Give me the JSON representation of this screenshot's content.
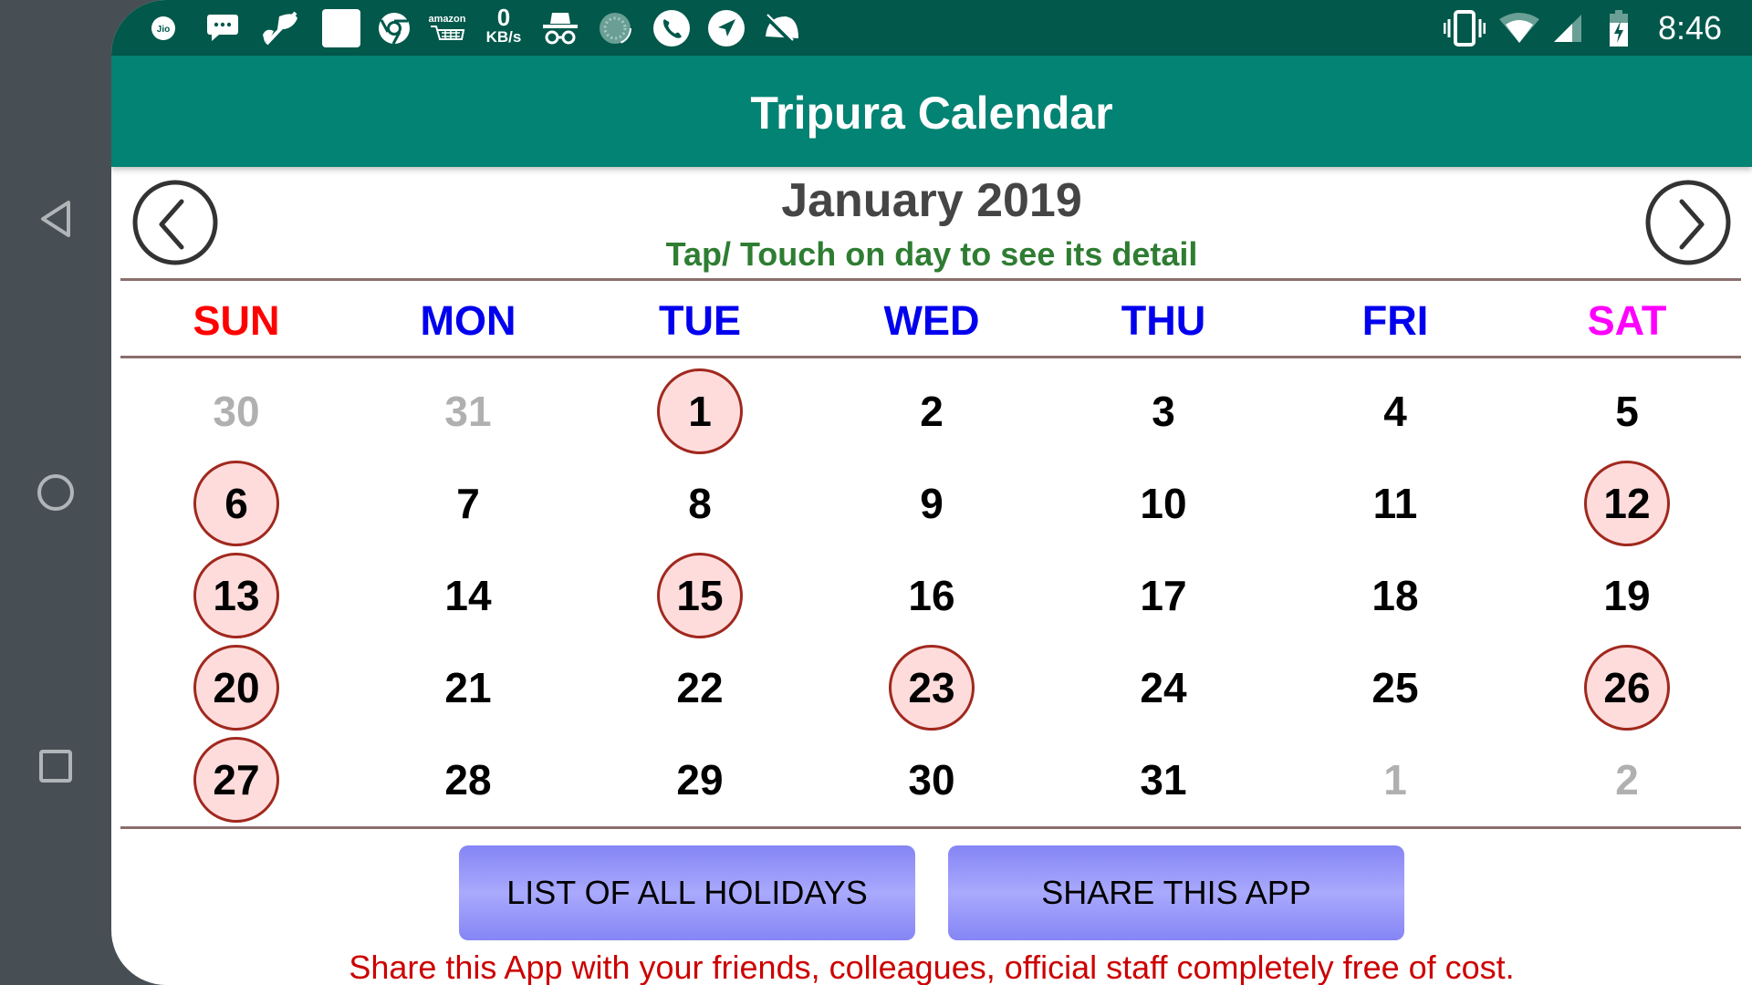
{
  "system_nav": {
    "back": "back-icon",
    "home": "home-icon",
    "recents": "recents-icon"
  },
  "status_bar": {
    "left_icons": [
      "jio-icon",
      "message-icon",
      "leaf-off-icon",
      "blank-notification-icon",
      "chrome-icon",
      "amazon-cart-icon"
    ],
    "net_speed_value": "0",
    "net_speed_unit": "KB/s",
    "left_icons_2": [
      "incognito-icon",
      "loading-icon",
      "phone-icon",
      "navigation-icon",
      "data-saver-off-icon"
    ],
    "right_icons": [
      "vibrate-icon",
      "wifi-icon",
      "signal-icon",
      "battery-charging-icon"
    ],
    "time": "8:46"
  },
  "app_bar": {
    "title": "Tripura Calendar"
  },
  "calendar": {
    "month_title": "January 2019",
    "subtitle": "Tap/ Touch on day to see its detail",
    "prev_label": "Previous month",
    "next_label": "Next month",
    "weekdays": [
      {
        "label": "SUN",
        "color": "#ff0000"
      },
      {
        "label": "MON",
        "color": "#0000ee"
      },
      {
        "label": "TUE",
        "color": "#0000ee"
      },
      {
        "label": "WED",
        "color": "#0000ee"
      },
      {
        "label": "THU",
        "color": "#0000ee"
      },
      {
        "label": "FRI",
        "color": "#0000ee"
      },
      {
        "label": "SAT",
        "color": "#ff00ff"
      }
    ],
    "weeks": [
      [
        {
          "d": "30",
          "type": "other"
        },
        {
          "d": "31",
          "type": "other"
        },
        {
          "d": "1",
          "type": "holiday"
        },
        {
          "d": "2",
          "type": "normal"
        },
        {
          "d": "3",
          "type": "normal"
        },
        {
          "d": "4",
          "type": "normal"
        },
        {
          "d": "5",
          "type": "normal"
        }
      ],
      [
        {
          "d": "6",
          "type": "holiday"
        },
        {
          "d": "7",
          "type": "normal"
        },
        {
          "d": "8",
          "type": "normal"
        },
        {
          "d": "9",
          "type": "normal"
        },
        {
          "d": "10",
          "type": "normal"
        },
        {
          "d": "11",
          "type": "normal"
        },
        {
          "d": "12",
          "type": "holiday"
        }
      ],
      [
        {
          "d": "13",
          "type": "holiday"
        },
        {
          "d": "14",
          "type": "normal"
        },
        {
          "d": "15",
          "type": "holiday"
        },
        {
          "d": "16",
          "type": "normal"
        },
        {
          "d": "17",
          "type": "normal"
        },
        {
          "d": "18",
          "type": "normal"
        },
        {
          "d": "19",
          "type": "normal"
        }
      ],
      [
        {
          "d": "20",
          "type": "holiday"
        },
        {
          "d": "21",
          "type": "normal"
        },
        {
          "d": "22",
          "type": "normal"
        },
        {
          "d": "23",
          "type": "holiday"
        },
        {
          "d": "24",
          "type": "normal"
        },
        {
          "d": "25",
          "type": "normal"
        },
        {
          "d": "26",
          "type": "holiday"
        }
      ],
      [
        {
          "d": "27",
          "type": "holiday"
        },
        {
          "d": "28",
          "type": "normal"
        },
        {
          "d": "29",
          "type": "normal"
        },
        {
          "d": "30",
          "type": "normal"
        },
        {
          "d": "31",
          "type": "normal"
        },
        {
          "d": "1",
          "type": "other"
        },
        {
          "d": "2",
          "type": "other"
        }
      ]
    ]
  },
  "buttons": {
    "holidays_label": "LIST OF ALL HOLIDAYS",
    "share_label": "SHARE THIS APP"
  },
  "footer": {
    "text": "Share this App with your friends, colleagues, official staff completely free of cost."
  },
  "colors": {
    "status_bar": "#01584b",
    "app_bar": "#028373",
    "holiday_ring": "#a0281e",
    "holiday_fill": "#ffdcdc",
    "subtitle": "#2e7d32",
    "footer_text": "#cc0000"
  }
}
